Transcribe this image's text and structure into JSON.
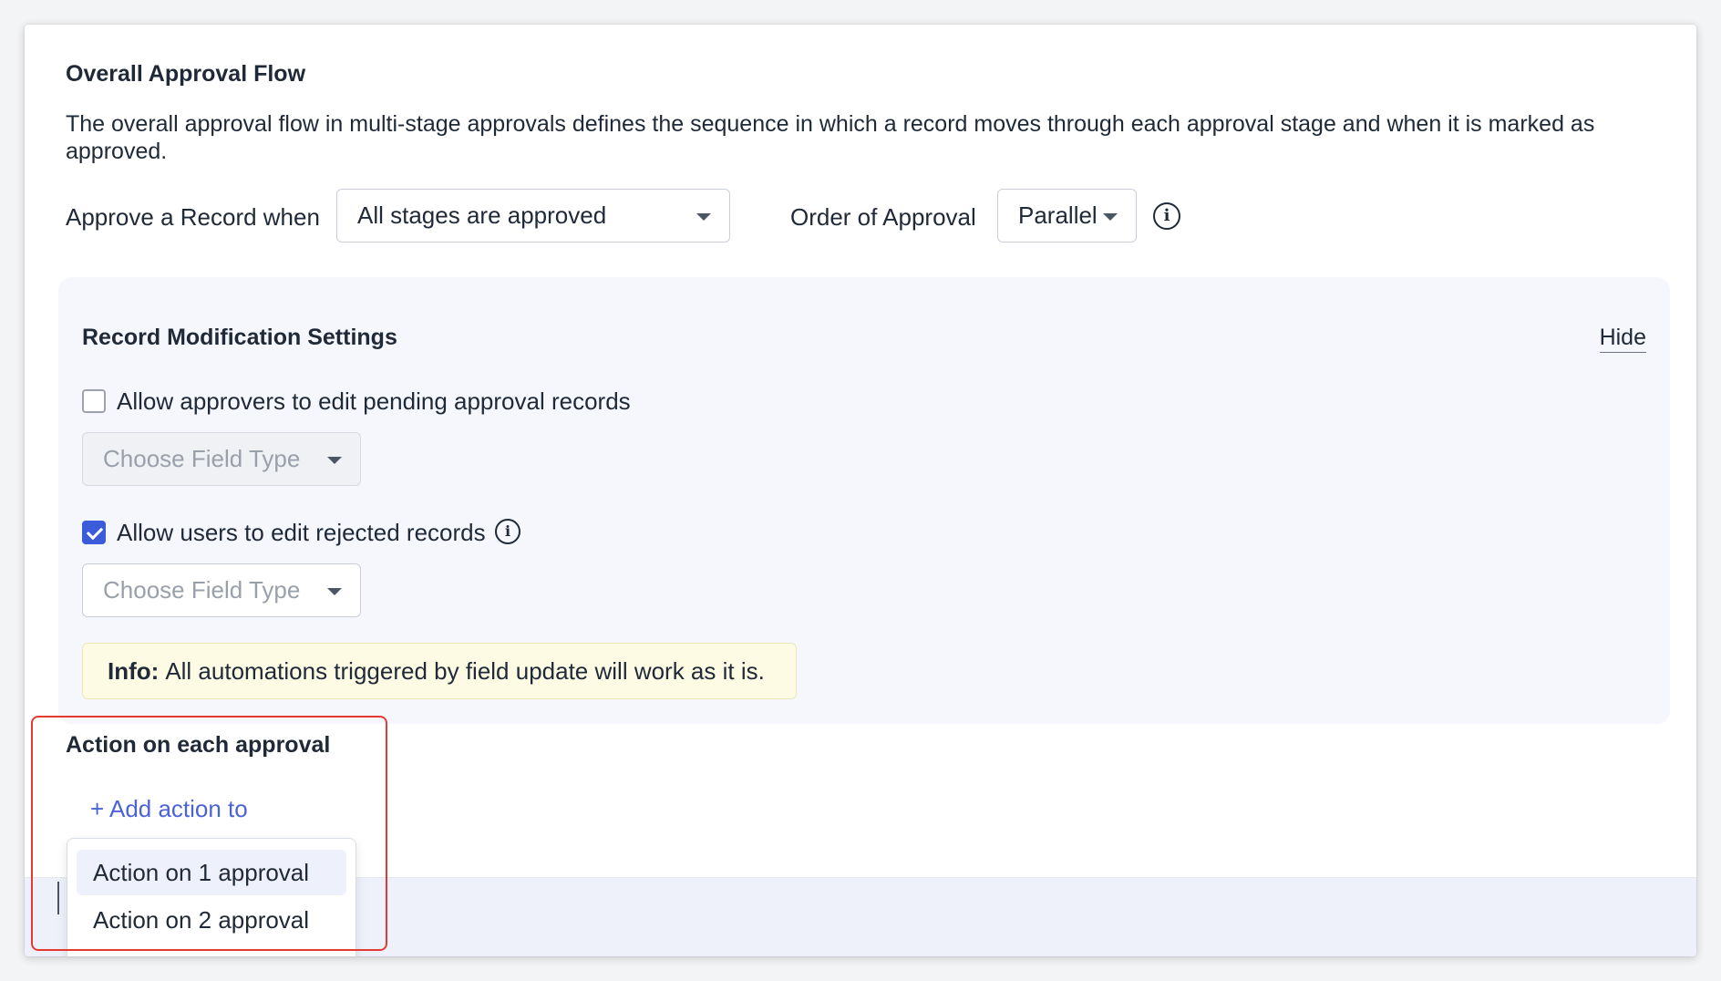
{
  "flow": {
    "title": "Overall Approval Flow",
    "description": "The overall approval flow in multi-stage approvals defines the sequence in which a record moves through each approval stage and when it is marked as approved.",
    "approve_label": "Approve a Record when",
    "approve_value": "All stages are approved",
    "order_label": "Order of Approval",
    "order_value": "Parallel"
  },
  "modification": {
    "title": "Record Modification Settings",
    "hide_label": "Hide",
    "options": [
      {
        "label": "Allow approvers to edit pending approval records",
        "checked": false,
        "field_type": "Choose Field Type"
      },
      {
        "label": "Allow users to edit rejected records",
        "checked": true,
        "field_type": "Choose Field Type"
      }
    ],
    "info_prefix": "Info:",
    "info_text": "All automations triggered by field update will work as it is."
  },
  "actions": {
    "title": "Action on each approval",
    "add_label": "+ Add action to",
    "menu": [
      "Action on 1 approval",
      "Action on 2 approval"
    ]
  },
  "colors": {
    "accent": "#3b5bdb",
    "link": "#4c63d8",
    "highlight": "#e53935",
    "info_bg": "#fdfbe4"
  },
  "icons": {
    "info": "info-circle-icon",
    "caret": "caret-down-icon",
    "check": "check-icon"
  }
}
